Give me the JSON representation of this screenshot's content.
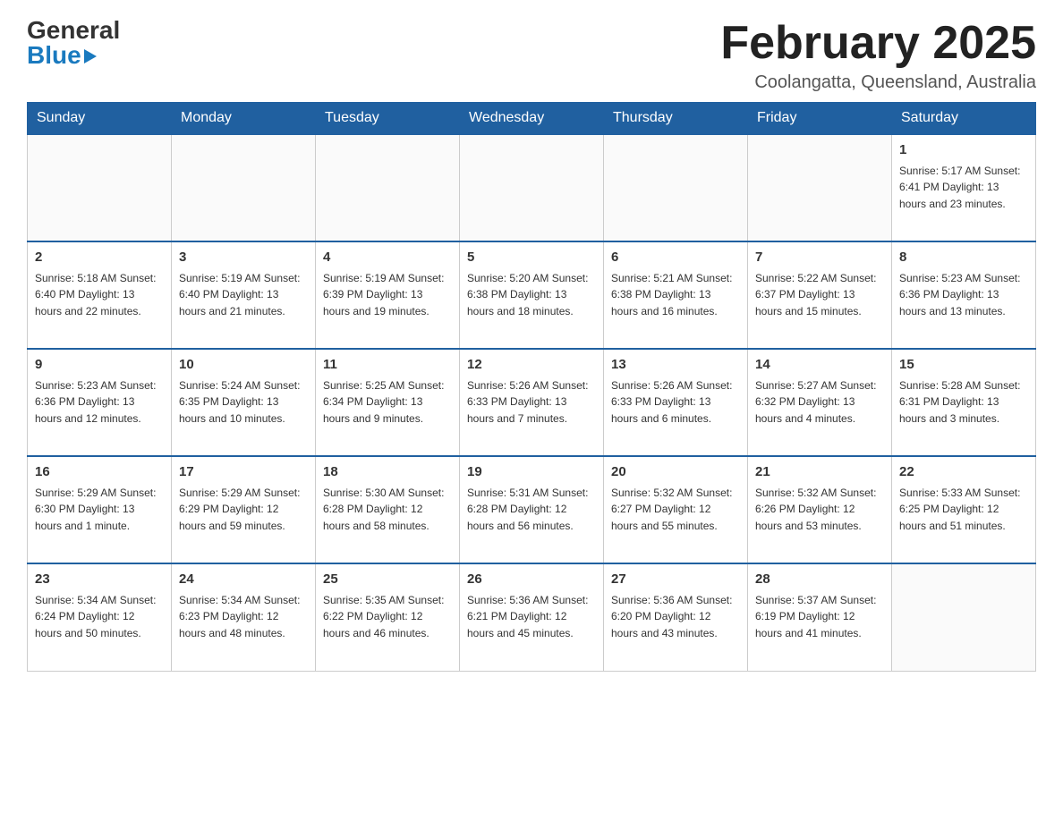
{
  "header": {
    "logo": {
      "general_text": "General",
      "blue_text": "Blue"
    },
    "month_title": "February 2025",
    "location": "Coolangatta, Queensland, Australia"
  },
  "weekdays": [
    "Sunday",
    "Monday",
    "Tuesday",
    "Wednesday",
    "Thursday",
    "Friday",
    "Saturday"
  ],
  "weeks": [
    [
      {
        "day": "",
        "info": ""
      },
      {
        "day": "",
        "info": ""
      },
      {
        "day": "",
        "info": ""
      },
      {
        "day": "",
        "info": ""
      },
      {
        "day": "",
        "info": ""
      },
      {
        "day": "",
        "info": ""
      },
      {
        "day": "1",
        "info": "Sunrise: 5:17 AM\nSunset: 6:41 PM\nDaylight: 13 hours\nand 23 minutes."
      }
    ],
    [
      {
        "day": "2",
        "info": "Sunrise: 5:18 AM\nSunset: 6:40 PM\nDaylight: 13 hours\nand 22 minutes."
      },
      {
        "day": "3",
        "info": "Sunrise: 5:19 AM\nSunset: 6:40 PM\nDaylight: 13 hours\nand 21 minutes."
      },
      {
        "day": "4",
        "info": "Sunrise: 5:19 AM\nSunset: 6:39 PM\nDaylight: 13 hours\nand 19 minutes."
      },
      {
        "day": "5",
        "info": "Sunrise: 5:20 AM\nSunset: 6:38 PM\nDaylight: 13 hours\nand 18 minutes."
      },
      {
        "day": "6",
        "info": "Sunrise: 5:21 AM\nSunset: 6:38 PM\nDaylight: 13 hours\nand 16 minutes."
      },
      {
        "day": "7",
        "info": "Sunrise: 5:22 AM\nSunset: 6:37 PM\nDaylight: 13 hours\nand 15 minutes."
      },
      {
        "day": "8",
        "info": "Sunrise: 5:23 AM\nSunset: 6:36 PM\nDaylight: 13 hours\nand 13 minutes."
      }
    ],
    [
      {
        "day": "9",
        "info": "Sunrise: 5:23 AM\nSunset: 6:36 PM\nDaylight: 13 hours\nand 12 minutes."
      },
      {
        "day": "10",
        "info": "Sunrise: 5:24 AM\nSunset: 6:35 PM\nDaylight: 13 hours\nand 10 minutes."
      },
      {
        "day": "11",
        "info": "Sunrise: 5:25 AM\nSunset: 6:34 PM\nDaylight: 13 hours\nand 9 minutes."
      },
      {
        "day": "12",
        "info": "Sunrise: 5:26 AM\nSunset: 6:33 PM\nDaylight: 13 hours\nand 7 minutes."
      },
      {
        "day": "13",
        "info": "Sunrise: 5:26 AM\nSunset: 6:33 PM\nDaylight: 13 hours\nand 6 minutes."
      },
      {
        "day": "14",
        "info": "Sunrise: 5:27 AM\nSunset: 6:32 PM\nDaylight: 13 hours\nand 4 minutes."
      },
      {
        "day": "15",
        "info": "Sunrise: 5:28 AM\nSunset: 6:31 PM\nDaylight: 13 hours\nand 3 minutes."
      }
    ],
    [
      {
        "day": "16",
        "info": "Sunrise: 5:29 AM\nSunset: 6:30 PM\nDaylight: 13 hours\nand 1 minute."
      },
      {
        "day": "17",
        "info": "Sunrise: 5:29 AM\nSunset: 6:29 PM\nDaylight: 12 hours\nand 59 minutes."
      },
      {
        "day": "18",
        "info": "Sunrise: 5:30 AM\nSunset: 6:28 PM\nDaylight: 12 hours\nand 58 minutes."
      },
      {
        "day": "19",
        "info": "Sunrise: 5:31 AM\nSunset: 6:28 PM\nDaylight: 12 hours\nand 56 minutes."
      },
      {
        "day": "20",
        "info": "Sunrise: 5:32 AM\nSunset: 6:27 PM\nDaylight: 12 hours\nand 55 minutes."
      },
      {
        "day": "21",
        "info": "Sunrise: 5:32 AM\nSunset: 6:26 PM\nDaylight: 12 hours\nand 53 minutes."
      },
      {
        "day": "22",
        "info": "Sunrise: 5:33 AM\nSunset: 6:25 PM\nDaylight: 12 hours\nand 51 minutes."
      }
    ],
    [
      {
        "day": "23",
        "info": "Sunrise: 5:34 AM\nSunset: 6:24 PM\nDaylight: 12 hours\nand 50 minutes."
      },
      {
        "day": "24",
        "info": "Sunrise: 5:34 AM\nSunset: 6:23 PM\nDaylight: 12 hours\nand 48 minutes."
      },
      {
        "day": "25",
        "info": "Sunrise: 5:35 AM\nSunset: 6:22 PM\nDaylight: 12 hours\nand 46 minutes."
      },
      {
        "day": "26",
        "info": "Sunrise: 5:36 AM\nSunset: 6:21 PM\nDaylight: 12 hours\nand 45 minutes."
      },
      {
        "day": "27",
        "info": "Sunrise: 5:36 AM\nSunset: 6:20 PM\nDaylight: 12 hours\nand 43 minutes."
      },
      {
        "day": "28",
        "info": "Sunrise: 5:37 AM\nSunset: 6:19 PM\nDaylight: 12 hours\nand 41 minutes."
      },
      {
        "day": "",
        "info": ""
      }
    ]
  ]
}
